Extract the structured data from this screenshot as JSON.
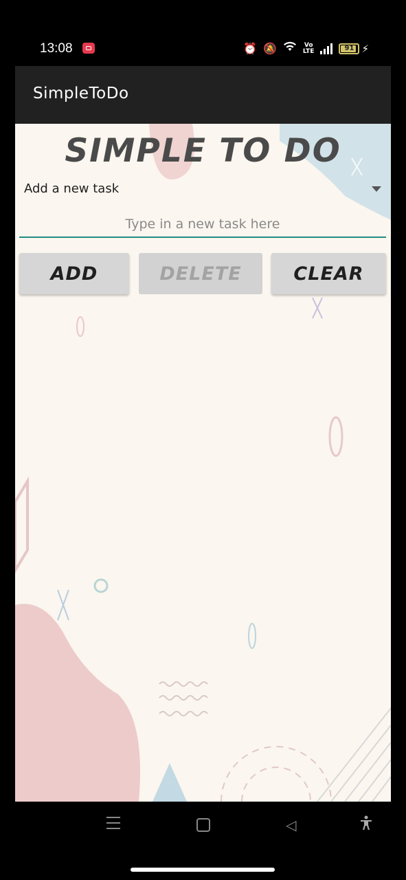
{
  "status_bar": {
    "time": "13:08",
    "volte_line1": "Vo",
    "volte_line2": "LTE",
    "battery_level": "91",
    "icons": [
      "screen-record-icon",
      "alarm-icon",
      "silent-bell-icon",
      "wifi-icon",
      "volte-icon",
      "signal-icon",
      "battery-icon",
      "charging-icon"
    ]
  },
  "app_bar": {
    "title": "SimpleToDo"
  },
  "main": {
    "heading": "SIMPLE TO DO",
    "dropdown_selected": "Add a new task",
    "input_placeholder": "Type in a new task here",
    "input_value": "",
    "buttons": {
      "add": "ADD",
      "delete": "DELETE",
      "clear": "CLEAR"
    },
    "delete_enabled": false
  },
  "colors": {
    "app_bar": "#212121",
    "content_bg": "#fbf6ef",
    "input_underline": "#1f8c83",
    "button_bg": "#d6d6d6",
    "heading": "#4a4a4a"
  },
  "nav_bar": {
    "icons": [
      "menu-icon",
      "home-icon",
      "back-icon",
      "accessibility-icon"
    ]
  }
}
